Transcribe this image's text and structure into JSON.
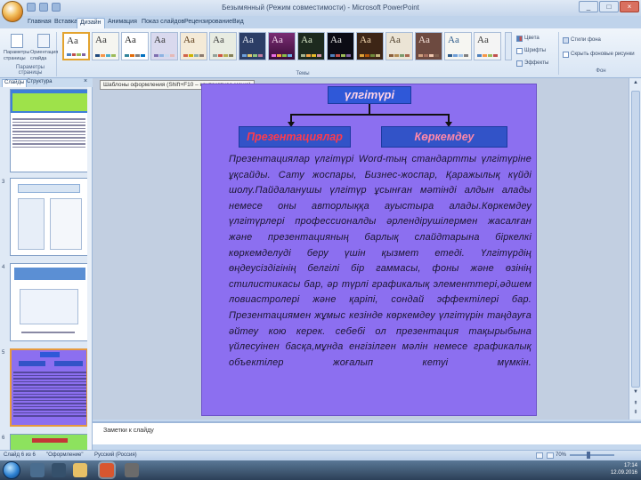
{
  "window": {
    "title": "Безымянный (Режим совместимости) - Microsoft PowerPoint",
    "controls": [
      "_",
      "□",
      "×"
    ]
  },
  "ribbon": {
    "tabs": [
      "Главная",
      "Вставка",
      "Дизайн",
      "Анимация",
      "Показ слайдов",
      "Рецензирование",
      "Вид"
    ],
    "active_tab": "Дизайн",
    "page_setup": {
      "btn1": "Параметры страницы",
      "btn2": "Ориентация слайда",
      "group_label": "Параметры страницы"
    },
    "themes_group_label": "Темы",
    "theme_sample": "Aa",
    "theme_options": {
      "colors": "Цвета",
      "fonts": "Шрифты",
      "effects": "Эффекты"
    },
    "background": {
      "styles": "Стили фона",
      "hide": "Скрыть фоновые рисунки",
      "group_label": "Фон"
    }
  },
  "left_panel": {
    "tabs": [
      "Слайды",
      "Структура"
    ],
    "active_tab": "Слайды",
    "close": "×",
    "slide_numbers": [
      "",
      "3",
      "4",
      "5",
      "6"
    ]
  },
  "tooltip": "Шаблоны оформления (Shift+F10 – контекстное меню)",
  "slide": {
    "title": "үлгітүрі",
    "box_left": "Презентациялар",
    "box_right": "Көркемдеу",
    "body": "Презентациялар үлгітүрі Word-тың стандартты үлгітүріне ұқсайды. Сату жоспары, Бизнес-жоспар, Қаражылық күйді шолу.Пайдаланушы үлгітүр ұсынған мәтінді алдын алады немесе оны авторлыққа ауыстыра алады.Көркемдеу үлгітүрлері профессионалды әрлендірушілермен жасалған және презентацияның барлық слайдтарына біркелкі көркемделуді беру үшін қызмет етеді. Үлгітүрдің өңдеусіздігінің белгілі бір гаммасы, фоны және өзінің стилистикасы бар, әр түрлі графикалық элементтері,әдшем ловиастролері және қаріпі, сондай эффектілері бар. Презентациямен жұмыс кезінде көркемдеу үлгітүрін таңдауға әйтеу кою керек. себебі ол презентация тақырыбына үйлесуінен басқа,мұнда енгізілген мәлін немесе графикалық объектілер жоғалып кетуі мүмкін."
  },
  "notes": {
    "placeholder": "Заметки к слайду"
  },
  "status": {
    "slide": "Слайд 6 из 6",
    "theme": "\"Оформление\"",
    "lang": "Русский (Россия)",
    "zoom": "70%"
  },
  "tray": {
    "time": "17:14",
    "date": "12.09.2016"
  },
  "colors": {
    "slide_bg": "#8c6ff0",
    "title_box": "#2f58d8",
    "box_left_text": "#ff3b4c",
    "box_right_text": "#ff88a8"
  }
}
